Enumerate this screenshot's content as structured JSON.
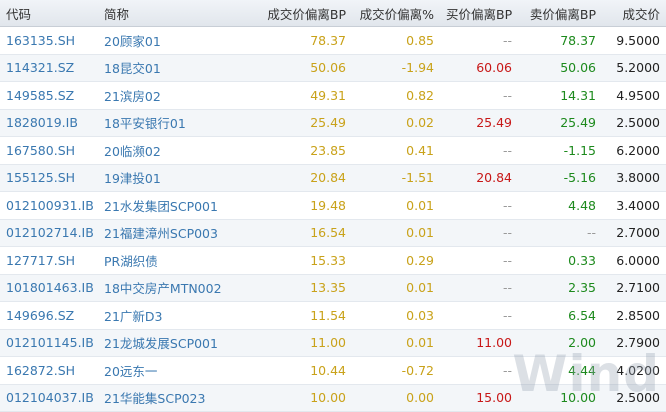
{
  "columns": [
    "代码",
    "简称",
    "成交价偏离BP",
    "成交价偏离%",
    "买价偏离BP",
    "卖价偏离BP",
    "成交价"
  ],
  "rows": [
    {
      "code": "163135.SH",
      "name": "20顾家01",
      "deal_bp": "78.37",
      "deal_pct": "0.85",
      "bid_bp": "--",
      "ask_bp": "78.37",
      "price": "9.5000"
    },
    {
      "code": "114321.SZ",
      "name": "18昆交01",
      "deal_bp": "50.06",
      "deal_pct": "-1.94",
      "bid_bp": "60.06",
      "ask_bp": "50.06",
      "price": "5.2000"
    },
    {
      "code": "149585.SZ",
      "name": "21滨房02",
      "deal_bp": "49.31",
      "deal_pct": "0.82",
      "bid_bp": "--",
      "ask_bp": "14.31",
      "price": "4.9500"
    },
    {
      "code": "1828019.IB",
      "name": "18平安银行01",
      "deal_bp": "25.49",
      "deal_pct": "0.02",
      "bid_bp": "25.49",
      "ask_bp": "25.49",
      "price": "2.5000"
    },
    {
      "code": "167580.SH",
      "name": "20临濒02",
      "deal_bp": "23.85",
      "deal_pct": "0.41",
      "bid_bp": "--",
      "ask_bp": "-1.15",
      "price": "6.2000"
    },
    {
      "code": "155125.SH",
      "name": "19津投01",
      "deal_bp": "20.84",
      "deal_pct": "-1.51",
      "bid_bp": "20.84",
      "ask_bp": "-5.16",
      "price": "3.8000"
    },
    {
      "code": "012100931.IB",
      "name": "21水发集团SCP001",
      "deal_bp": "19.48",
      "deal_pct": "0.01",
      "bid_bp": "--",
      "ask_bp": "4.48",
      "price": "3.4000"
    },
    {
      "code": "012102714.IB",
      "name": "21福建漳州SCP003",
      "deal_bp": "16.54",
      "deal_pct": "0.01",
      "bid_bp": "--",
      "ask_bp": "--",
      "price": "2.7000"
    },
    {
      "code": "127717.SH",
      "name": "PR湖织债",
      "deal_bp": "15.33",
      "deal_pct": "0.29",
      "bid_bp": "--",
      "ask_bp": "0.33",
      "price": "6.0000"
    },
    {
      "code": "101801463.IB",
      "name": "18中交房产MTN002",
      "deal_bp": "13.35",
      "deal_pct": "0.01",
      "bid_bp": "--",
      "ask_bp": "2.35",
      "price": "2.7100"
    },
    {
      "code": "149696.SZ",
      "name": "21广新D3",
      "deal_bp": "11.54",
      "deal_pct": "0.03",
      "bid_bp": "--",
      "ask_bp": "6.54",
      "price": "2.8500"
    },
    {
      "code": "012101145.IB",
      "name": "21龙城发展SCP001",
      "deal_bp": "11.00",
      "deal_pct": "0.01",
      "bid_bp": "11.00",
      "ask_bp": "2.00",
      "price": "2.7900"
    },
    {
      "code": "162872.SH",
      "name": "20远东一",
      "deal_bp": "10.44",
      "deal_pct": "-0.72",
      "bid_bp": "--",
      "ask_bp": "4.44",
      "price": "4.0200"
    },
    {
      "code": "012104037.IB",
      "name": "21华能集SCP023",
      "deal_bp": "10.00",
      "deal_pct": "0.00",
      "bid_bp": "15.00",
      "ask_bp": "10.00",
      "price": "2.5000"
    }
  ],
  "colors": {
    "code": "#3a78b0",
    "deal": "#c9a21a",
    "bid": "#c81818",
    "ask": "#1d8a1d",
    "dash": "#9a9a9a"
  },
  "watermark": "Wind"
}
